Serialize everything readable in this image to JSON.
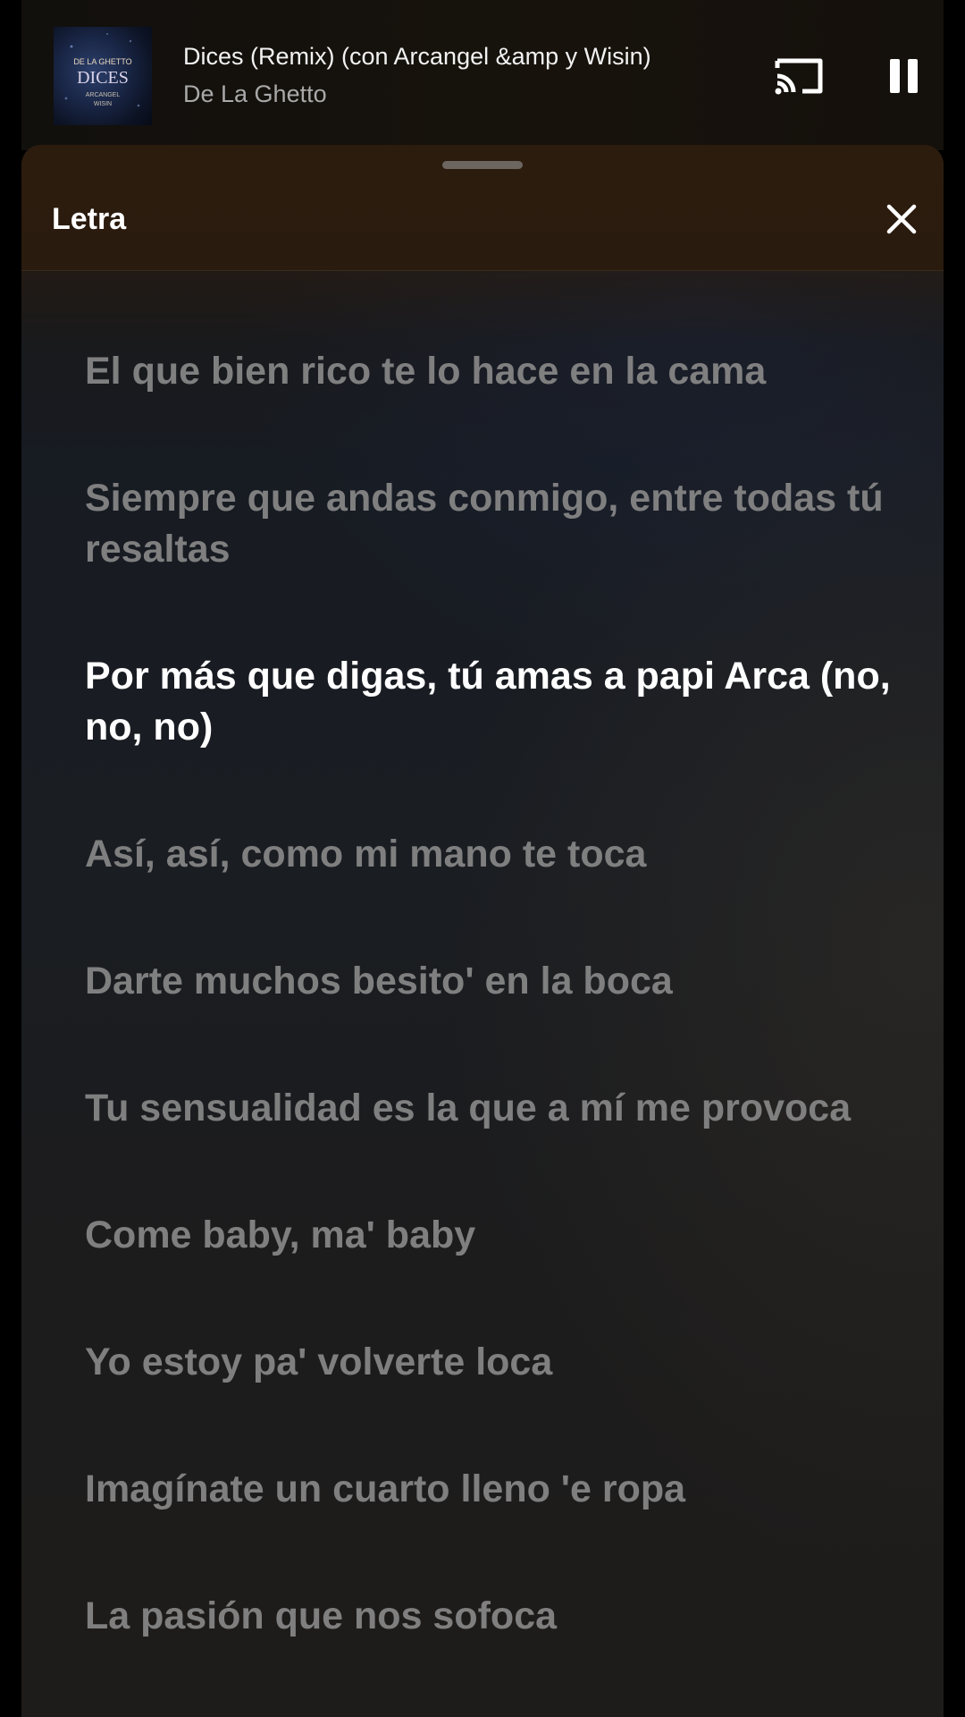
{
  "player": {
    "song_title": "Dices (Remix) (con Arcangel &amp y Wisin)",
    "artist": "De La Ghetto",
    "album_art_text": [
      "DE LA GHETTO",
      "DICES",
      "ARCANGEL",
      "WISIN"
    ]
  },
  "sheet": {
    "title": "Letra"
  },
  "lyrics": {
    "lines": [
      "El que bien rico te lo hace en la cama",
      "Siempre que andas conmigo, entre todas tú resaltas",
      "Por más que digas, tú amas a papi Arca (no, no, no)",
      "Así, así, como mi mano te toca",
      "Darte muchos besito' en la boca",
      "Tu sensualidad es la que a mí me provoca",
      "Come baby, ma' baby",
      "Yo estoy pa' volverte loca",
      "Imagínate un cuarto lleno 'e ropa",
      "La pasión que nos sofoca"
    ],
    "active_index": 2
  },
  "icons": {
    "cast": "cast-icon",
    "pause": "pause-icon",
    "close": "close-icon"
  },
  "colors": {
    "active_lyric": "#ffffff",
    "inactive_lyric": "#7f7f80",
    "header_bg": "#2c1c0e"
  }
}
